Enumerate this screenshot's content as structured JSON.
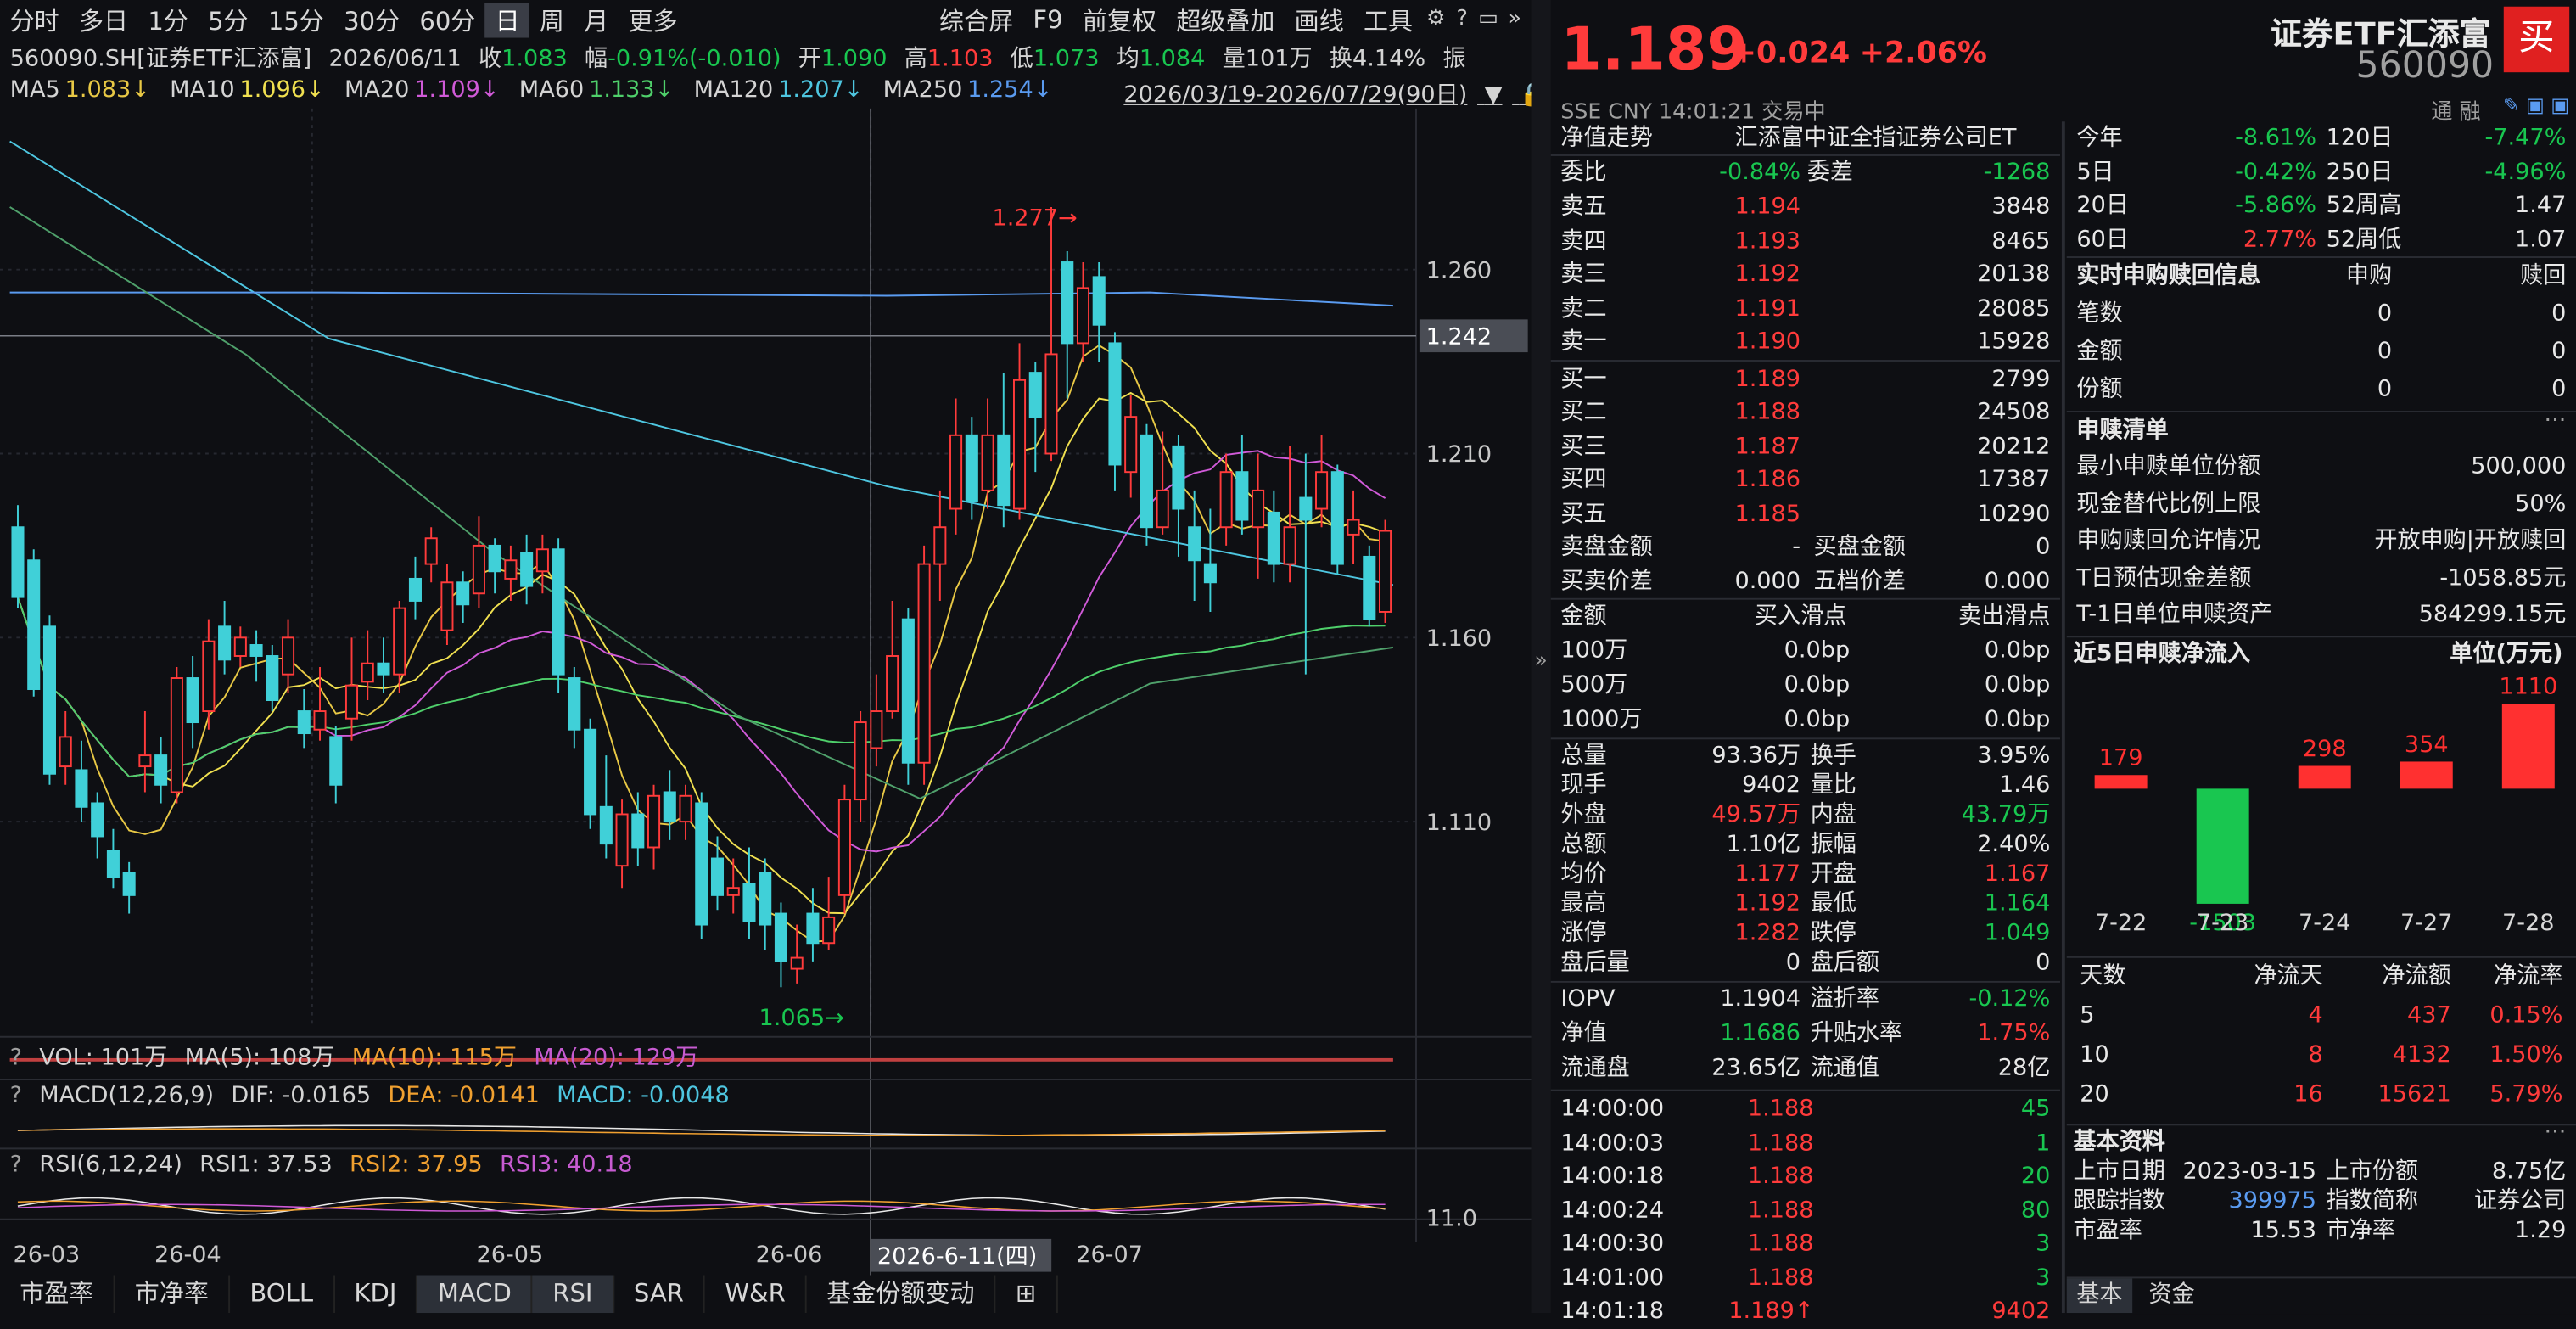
{
  "toolbar": {
    "periods": [
      "分时",
      "多日",
      "1分",
      "5分",
      "15分",
      "30分",
      "60分",
      "日",
      "周",
      "月",
      "更多"
    ],
    "selected": "日",
    "right": [
      "综合屏",
      "F9",
      "前复权",
      "超级叠加",
      "画线",
      "工具"
    ]
  },
  "quote_line": {
    "code": "560090.SH[证券ETF汇添富]",
    "date": "2026/06/11",
    "close_label": "收",
    "close": "1.083",
    "chg_label": "幅",
    "chg": "-0.91%(-0.010)",
    "open_label": "开",
    "open": "1.090",
    "high_label": "高",
    "high": "1.103",
    "low_label": "低",
    "low": "1.073",
    "avg_label": "均",
    "avg": "1.084",
    "vol_label": "量",
    "vol": "101万",
    "turn_label": "换",
    "turn": "4.14%",
    "amp_label": "振"
  },
  "ma_line": {
    "items": [
      {
        "label": "MA5",
        "value": "1.083↓",
        "color": "#e8c845"
      },
      {
        "label": "MA10",
        "value": "1.096↓",
        "color": "#f0e050"
      },
      {
        "label": "MA20",
        "value": "1.109↓",
        "color": "#d05ad8"
      },
      {
        "label": "MA60",
        "value": "1.133↓",
        "color": "#4fd06b"
      },
      {
        "label": "MA120",
        "value": "1.207↓",
        "color": "#4ec6e0"
      },
      {
        "label": "MA250",
        "value": "1.254↓",
        "color": "#5a9bf0"
      }
    ],
    "range": "2026/03/19-2026/07/29(90日)"
  },
  "chart_data": {
    "type": "candlestick",
    "y_ticks": [
      "1.260",
      "1.210",
      "1.160",
      "1.110"
    ],
    "ylim": [
      1.06,
      1.277
    ],
    "crosshair_price": "1.242",
    "max_label": "1.277→",
    "min_label": "1.065→",
    "x_labels": [
      "26-03",
      "26-04",
      "26-05",
      "26-06",
      "26-07"
    ],
    "crosshair_date": "2026-6-11(四)",
    "candles": [
      {
        "o": 1.19,
        "c": 1.171,
        "h": 1.196,
        "l": 1.168
      },
      {
        "o": 1.181,
        "c": 1.146,
        "h": 1.184,
        "l": 1.144
      },
      {
        "o": 1.163,
        "c": 1.123,
        "h": 1.166,
        "l": 1.12
      },
      {
        "o": 1.125,
        "c": 1.133,
        "h": 1.14,
        "l": 1.12
      },
      {
        "o": 1.124,
        "c": 1.114,
        "h": 1.132,
        "l": 1.11
      },
      {
        "o": 1.115,
        "c": 1.106,
        "h": 1.118,
        "l": 1.1
      },
      {
        "o": 1.102,
        "c": 1.095,
        "h": 1.108,
        "l": 1.092
      },
      {
        "o": 1.096,
        "c": 1.09,
        "h": 1.099,
        "l": 1.085
      },
      {
        "o": 1.125,
        "c": 1.128,
        "h": 1.14,
        "l": 1.118
      },
      {
        "o": 1.128,
        "c": 1.12,
        "h": 1.133,
        "l": 1.115
      },
      {
        "o": 1.118,
        "c": 1.149,
        "h": 1.152,
        "l": 1.115
      },
      {
        "o": 1.149,
        "c": 1.137,
        "h": 1.155,
        "l": 1.13
      },
      {
        "o": 1.14,
        "c": 1.159,
        "h": 1.165,
        "l": 1.135
      },
      {
        "o": 1.163,
        "c": 1.154,
        "h": 1.17,
        "l": 1.15
      },
      {
        "o": 1.155,
        "c": 1.16,
        "h": 1.163,
        "l": 1.152
      },
      {
        "o": 1.158,
        "c": 1.155,
        "h": 1.162,
        "l": 1.148
      },
      {
        "o": 1.155,
        "c": 1.143,
        "h": 1.158,
        "l": 1.14
      },
      {
        "o": 1.15,
        "c": 1.16,
        "h": 1.165,
        "l": 1.145
      },
      {
        "o": 1.14,
        "c": 1.134,
        "h": 1.146,
        "l": 1.13
      },
      {
        "o": 1.135,
        "c": 1.14,
        "h": 1.152,
        "l": 1.132
      },
      {
        "o": 1.133,
        "c": 1.12,
        "h": 1.136,
        "l": 1.115
      },
      {
        "o": 1.138,
        "c": 1.147,
        "h": 1.16,
        "l": 1.132
      },
      {
        "o": 1.148,
        "c": 1.153,
        "h": 1.162,
        "l": 1.143
      },
      {
        "o": 1.153,
        "c": 1.15,
        "h": 1.16,
        "l": 1.145
      },
      {
        "o": 1.15,
        "c": 1.168,
        "h": 1.17,
        "l": 1.145
      },
      {
        "o": 1.176,
        "c": 1.17,
        "h": 1.182,
        "l": 1.165
      },
      {
        "o": 1.18,
        "c": 1.187,
        "h": 1.19,
        "l": 1.175
      },
      {
        "o": 1.162,
        "c": 1.175,
        "h": 1.18,
        "l": 1.158
      },
      {
        "o": 1.175,
        "c": 1.169,
        "h": 1.178,
        "l": 1.164
      },
      {
        "o": 1.172,
        "c": 1.185,
        "h": 1.193,
        "l": 1.168
      },
      {
        "o": 1.185,
        "c": 1.178,
        "h": 1.187,
        "l": 1.172
      },
      {
        "o": 1.176,
        "c": 1.181,
        "h": 1.185,
        "l": 1.17
      },
      {
        "o": 1.183,
        "c": 1.174,
        "h": 1.188,
        "l": 1.169
      },
      {
        "o": 1.178,
        "c": 1.184,
        "h": 1.188,
        "l": 1.172
      },
      {
        "o": 1.184,
        "c": 1.15,
        "h": 1.187,
        "l": 1.145
      },
      {
        "o": 1.149,
        "c": 1.135,
        "h": 1.152,
        "l": 1.13
      },
      {
        "o": 1.135,
        "c": 1.112,
        "h": 1.138,
        "l": 1.108
      },
      {
        "o": 1.114,
        "c": 1.104,
        "h": 1.128,
        "l": 1.1
      },
      {
        "o": 1.098,
        "c": 1.112,
        "h": 1.116,
        "l": 1.092
      },
      {
        "o": 1.112,
        "c": 1.103,
        "h": 1.118,
        "l": 1.098
      },
      {
        "o": 1.103,
        "c": 1.117,
        "h": 1.12,
        "l": 1.097
      },
      {
        "o": 1.118,
        "c": 1.11,
        "h": 1.124,
        "l": 1.105
      },
      {
        "o": 1.11,
        "c": 1.117,
        "h": 1.12,
        "l": 1.105
      },
      {
        "o": 1.115,
        "c": 1.082,
        "h": 1.118,
        "l": 1.078
      },
      {
        "o": 1.1,
        "c": 1.09,
        "h": 1.106,
        "l": 1.086
      },
      {
        "o": 1.09,
        "c": 1.092,
        "h": 1.1,
        "l": 1.085
      },
      {
        "o": 1.093,
        "c": 1.083,
        "h": 1.103,
        "l": 1.078
      },
      {
        "o": 1.096,
        "c": 1.082,
        "h": 1.1,
        "l": 1.075
      },
      {
        "o": 1.085,
        "c": 1.072,
        "h": 1.088,
        "l": 1.065
      },
      {
        "o": 1.07,
        "c": 1.073,
        "h": 1.082,
        "l": 1.066
      },
      {
        "o": 1.085,
        "c": 1.077,
        "h": 1.092,
        "l": 1.072
      },
      {
        "o": 1.077,
        "c": 1.084,
        "h": 1.095,
        "l": 1.075
      },
      {
        "o": 1.09,
        "c": 1.116,
        "h": 1.12,
        "l": 1.085
      },
      {
        "o": 1.116,
        "c": 1.137,
        "h": 1.14,
        "l": 1.11
      },
      {
        "o": 1.13,
        "c": 1.14,
        "h": 1.15,
        "l": 1.125
      },
      {
        "o": 1.14,
        "c": 1.155,
        "h": 1.17,
        "l": 1.138
      },
      {
        "o": 1.165,
        "c": 1.126,
        "h": 1.168,
        "l": 1.12
      },
      {
        "o": 1.126,
        "c": 1.18,
        "h": 1.185,
        "l": 1.12
      },
      {
        "o": 1.18,
        "c": 1.19,
        "h": 1.2,
        "l": 1.17
      },
      {
        "o": 1.195,
        "c": 1.215,
        "h": 1.225,
        "l": 1.188
      },
      {
        "o": 1.215,
        "c": 1.197,
        "h": 1.22,
        "l": 1.192
      },
      {
        "o": 1.2,
        "c": 1.215,
        "h": 1.225,
        "l": 1.195
      },
      {
        "o": 1.215,
        "c": 1.196,
        "h": 1.232,
        "l": 1.19
      },
      {
        "o": 1.195,
        "c": 1.23,
        "h": 1.24,
        "l": 1.192
      },
      {
        "o": 1.232,
        "c": 1.22,
        "h": 1.235,
        "l": 1.205
      },
      {
        "o": 1.21,
        "c": 1.237,
        "h": 1.277,
        "l": 1.208
      },
      {
        "o": 1.262,
        "c": 1.24,
        "h": 1.265,
        "l": 1.225
      },
      {
        "o": 1.24,
        "c": 1.255,
        "h": 1.262,
        "l": 1.235
      },
      {
        "o": 1.258,
        "c": 1.245,
        "h": 1.262,
        "l": 1.235
      },
      {
        "o": 1.24,
        "c": 1.207,
        "h": 1.243,
        "l": 1.2
      },
      {
        "o": 1.205,
        "c": 1.22,
        "h": 1.226,
        "l": 1.198
      },
      {
        "o": 1.215,
        "c": 1.19,
        "h": 1.218,
        "l": 1.185
      },
      {
        "o": 1.19,
        "c": 1.2,
        "h": 1.216,
        "l": 1.188
      },
      {
        "o": 1.212,
        "c": 1.195,
        "h": 1.215,
        "l": 1.182
      },
      {
        "o": 1.19,
        "c": 1.181,
        "h": 1.2,
        "l": 1.17
      },
      {
        "o": 1.18,
        "c": 1.175,
        "h": 1.195,
        "l": 1.167
      },
      {
        "o": 1.19,
        "c": 1.205,
        "h": 1.21,
        "l": 1.185
      },
      {
        "o": 1.205,
        "c": 1.192,
        "h": 1.215,
        "l": 1.188
      },
      {
        "o": 1.19,
        "c": 1.2,
        "h": 1.21,
        "l": 1.176
      },
      {
        "o": 1.194,
        "c": 1.18,
        "h": 1.2,
        "l": 1.175
      },
      {
        "o": 1.18,
        "c": 1.19,
        "h": 1.212,
        "l": 1.175
      },
      {
        "o": 1.198,
        "c": 1.192,
        "h": 1.21,
        "l": 1.15
      },
      {
        "o": 1.195,
        "c": 1.205,
        "h": 1.215,
        "l": 1.19
      },
      {
        "o": 1.205,
        "c": 1.18,
        "h": 1.207,
        "l": 1.177
      },
      {
        "o": 1.188,
        "c": 1.192,
        "h": 1.2,
        "l": 1.18
      },
      {
        "o": 1.182,
        "c": 1.165,
        "h": 1.185,
        "l": 1.163
      },
      {
        "o": 1.167,
        "c": 1.189,
        "h": 1.192,
        "l": 1.164
      }
    ]
  },
  "vol_panel": {
    "label": "VOL: 101万",
    "ma5": "MA(5): 108万",
    "ma10": "MA(10): 115万",
    "ma20": "MA(20): 129万"
  },
  "macd_panel": {
    "label": "MACD(12,26,9)",
    "dif": "DIF: -0.0165",
    "dea": "DEA: -0.0141",
    "macd": "MACD: -0.0048"
  },
  "rsi_panel": {
    "label": "RSI(6,12,24)",
    "rsi1": "RSI1: 37.53",
    "rsi2": "RSI2: 37.95",
    "rsi3": "RSI3: 40.18",
    "level": "11.0"
  },
  "bottom_tabs": [
    "市盈率",
    "市净率",
    "BOLL",
    "KDJ",
    "MACD",
    "RSI",
    "SAR",
    "W&R",
    "基金份额变动",
    "⊞"
  ],
  "bottom_tabs_active": [
    "MACD",
    "RSI"
  ],
  "header": {
    "price": "1.189",
    "change": "+0.024",
    "pct": "+2.06%",
    "name": "证券ETF汇添富",
    "code": "560090",
    "buy_label": "买",
    "exchange": "SSE",
    "currency": "CNY",
    "time": "14:01:21",
    "status": "交易中",
    "tags": "通 融"
  },
  "orderbook": {
    "title1": "净值走势",
    "title2": "汇添富中证全指证券公司ET",
    "wei_bi_label": "委比",
    "wei_bi": "-0.84%",
    "wei_cha_label": "委差",
    "wei_cha": "-1268",
    "asks": [
      {
        "label": "卖五",
        "price": "1.194",
        "vol": "3848"
      },
      {
        "label": "卖四",
        "price": "1.193",
        "vol": "8465"
      },
      {
        "label": "卖三",
        "price": "1.192",
        "vol": "20138"
      },
      {
        "label": "卖二",
        "price": "1.191",
        "vol": "28085"
      },
      {
        "label": "卖一",
        "price": "1.190",
        "vol": "15928"
      }
    ],
    "bids": [
      {
        "label": "买一",
        "price": "1.189",
        "vol": "2799"
      },
      {
        "label": "买二",
        "price": "1.188",
        "vol": "24508"
      },
      {
        "label": "买三",
        "price": "1.187",
        "vol": "20212"
      },
      {
        "label": "买四",
        "price": "1.186",
        "vol": "17387"
      },
      {
        "label": "买五",
        "price": "1.185",
        "vol": "10290"
      }
    ],
    "extra": [
      [
        "卖盘金额",
        "-",
        "买盘金额",
        "0"
      ],
      [
        "买卖价差",
        "0.000",
        "五档价差",
        "0.000"
      ]
    ],
    "slip_hdr": [
      "金额",
      "买入滑点",
      "卖出滑点"
    ],
    "slip": [
      [
        "100万",
        "0.0bp",
        "0.0bp"
      ],
      [
        "500万",
        "0.0bp",
        "0.0bp"
      ],
      [
        "1000万",
        "0.0bp",
        "0.0bp"
      ]
    ],
    "stats": [
      [
        "总量",
        "93.36万",
        "",
        "换手",
        "3.95%",
        ""
      ],
      [
        "现手",
        "9402",
        "",
        "量比",
        "1.46",
        ""
      ],
      [
        "外盘",
        "49.57万",
        "red",
        "内盘",
        "43.79万",
        "green"
      ],
      [
        "总额",
        "1.10亿",
        "",
        "振幅",
        "2.40%",
        ""
      ],
      [
        "均价",
        "1.177",
        "red",
        "开盘",
        "1.167",
        "red"
      ],
      [
        "最高",
        "1.192",
        "red",
        "最低",
        "1.164",
        "green"
      ],
      [
        "涨停",
        "1.282",
        "red",
        "跌停",
        "1.049",
        "green"
      ],
      [
        "盘后量",
        "0",
        "",
        "盘后额",
        "0",
        ""
      ]
    ],
    "iopv": [
      [
        "IOPV",
        "1.1904",
        "",
        "溢折率",
        "-0.12%",
        "green"
      ],
      [
        "净值",
        "1.1686",
        "green",
        "升贴水率",
        "1.75%",
        "red"
      ],
      [
        "流通盘",
        "23.65亿",
        "",
        "流通值",
        "28亿",
        ""
      ]
    ],
    "ticks": [
      [
        "14:00:00",
        "1.188",
        "45",
        "green"
      ],
      [
        "14:00:03",
        "1.188",
        "1",
        "green"
      ],
      [
        "14:00:18",
        "1.188",
        "20",
        "green"
      ],
      [
        "14:00:24",
        "1.188",
        "80",
        "green"
      ],
      [
        "14:00:30",
        "1.188",
        "3",
        "green"
      ],
      [
        "14:01:00",
        "1.188",
        "3",
        "green"
      ],
      [
        "14:01:18",
        "1.189↑",
        "9402",
        "red"
      ]
    ]
  },
  "perf": [
    [
      "今年",
      "-8.61%",
      "green",
      "120日",
      "-7.47%",
      "green"
    ],
    [
      "5日",
      "-0.42%",
      "green",
      "250日",
      "-4.96%",
      "green"
    ],
    [
      "20日",
      "-5.86%",
      "green",
      "52周高",
      "1.47",
      ""
    ],
    [
      "60日",
      "2.77%",
      "red",
      "52周低",
      "1.07",
      ""
    ]
  ],
  "subscribe": {
    "title": "实时申购赎回信息",
    "col1": "申购",
    "col2": "赎回",
    "rows": [
      [
        "笔数",
        "0",
        "0"
      ],
      [
        "金额",
        "0",
        "0"
      ],
      [
        "份额",
        "0",
        "0"
      ]
    ]
  },
  "creation": {
    "title": "申赎清单",
    "rows": [
      [
        "最小申赎单位份额",
        "500,000"
      ],
      [
        "现金替代比例上限",
        "50%"
      ],
      [
        "申购赎回允许情况",
        "开放申购|开放赎回"
      ],
      [
        "T日预估现金差额",
        "-1058.85元"
      ],
      [
        "T-1日单位申赎资产",
        "584299.15元"
      ]
    ]
  },
  "netflow": {
    "title": "近5日申赎净流入",
    "unit": "单位(万元)",
    "dates": [
      "7-22",
      "7-23",
      "7-24",
      "7-27",
      "7-28"
    ],
    "values": [
      179,
      -1503,
      298,
      354,
      1110
    ]
  },
  "flowstats": {
    "hdr": [
      "天数",
      "净流天",
      "净流额",
      "净流率"
    ],
    "rows": [
      [
        "5",
        "4",
        "437",
        "0.15%"
      ],
      [
        "10",
        "8",
        "4132",
        "1.50%"
      ],
      [
        "20",
        "16",
        "15621",
        "5.79%"
      ]
    ]
  },
  "basic": {
    "title": "基本资料",
    "rows": [
      [
        "上市日期",
        "2023-03-15",
        "上市份额",
        "8.75亿"
      ],
      [
        "跟踪指数",
        "399975",
        "指数简称",
        "证券公司"
      ],
      [
        "市盈率",
        "15.53",
        "市净率",
        "1.29"
      ]
    ]
  },
  "right_tabs": [
    "基本",
    "资金"
  ]
}
